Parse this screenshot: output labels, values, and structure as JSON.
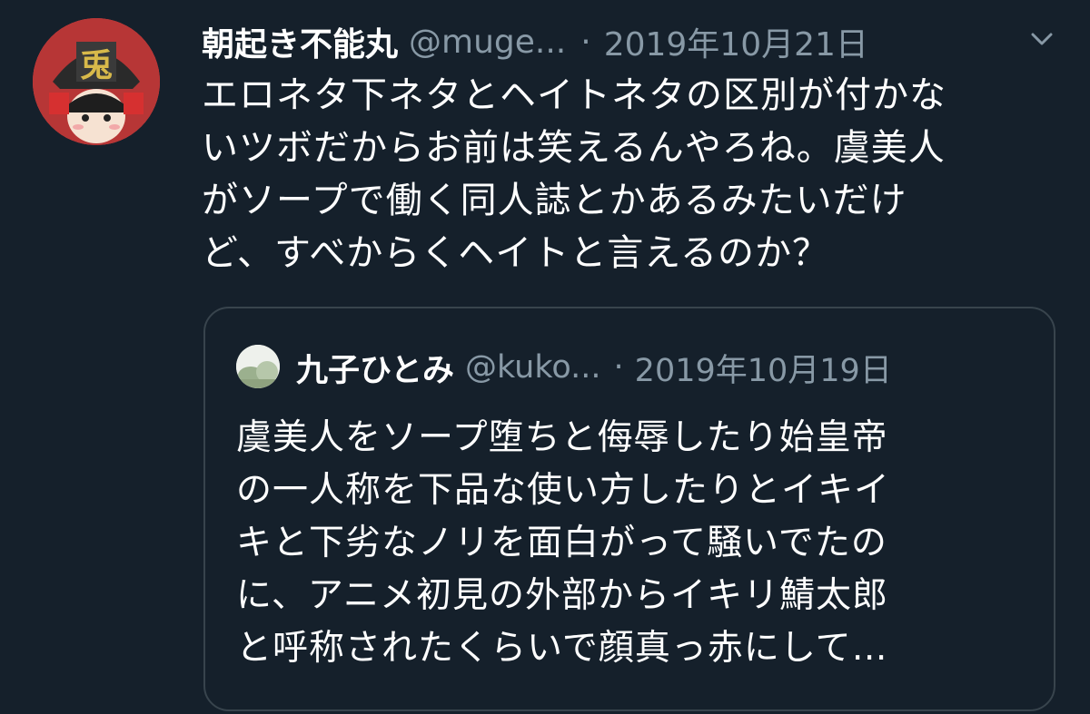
{
  "tweet": {
    "avatar_icon": "user-avatar-icon",
    "display_name": "朝起き不能丸",
    "handle": "@muge...",
    "separator": "·",
    "date": "2019年10月21日",
    "menu_icon": "chevron-down-icon",
    "lines": [
      "エロネタ下ネタとヘイトネタの区別が付かな",
      "いツボだからお前は笑えるんやろね。虞美人",
      "がソープで働く同人誌とかあるみたいだけ",
      "ど、すべからくヘイトと言えるのか？"
    ]
  },
  "quote": {
    "avatar_icon": "user-avatar-icon",
    "display_name": "九子ひとみ",
    "handle": "@kuko...",
    "separator": "·",
    "date": "2019年10月19日",
    "lines": [
      "虞美人をソープ堕ちと侮辱したり始皇帝",
      "の一人称を下品な使い方したりとイキイ",
      "キと下劣なノリを面白がって騒いでたの",
      "に、アニメ初見の外部からイキリ鯖太郎",
      "と呼称されたくらいで顔真っ赤にして…"
    ]
  },
  "colors": {
    "background": "#15202b",
    "secondary_text": "#8899a6",
    "border": "#38444d",
    "primary_text": "#ffffff"
  }
}
